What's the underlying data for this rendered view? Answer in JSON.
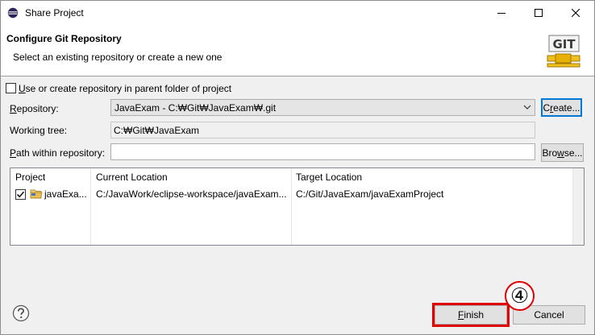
{
  "window": {
    "title": "Share Project"
  },
  "header": {
    "title": "Configure Git Repository",
    "subtitle": "Select an existing repository or create a new one",
    "logo_text": "GIT"
  },
  "form": {
    "use_parent_label_pre": "",
    "use_parent_label_u": "U",
    "use_parent_label_post": "se or create repository in parent folder of project",
    "use_parent_checked": false,
    "repository_label_pre": "",
    "repository_label_u": "R",
    "repository_label_post": "epository:",
    "repository_value": "JavaExam - C:₩Git₩JavaExam₩.git",
    "create_label_pre": "C",
    "create_label_u": "r",
    "create_label_post": "eate...",
    "working_tree_label": "Working tree:",
    "working_tree_value": "C:₩Git₩JavaExam",
    "path_label_pre": "",
    "path_label_u": "P",
    "path_label_post": "ath within repository:",
    "path_value": "",
    "browse_label_pre": "Bro",
    "browse_label_u": "w",
    "browse_label_post": "se..."
  },
  "table": {
    "columns": [
      "Project",
      "Current Location",
      "Target Location"
    ],
    "rows": [
      {
        "checked": true,
        "project": "javaExa...",
        "current": "C:/JavaWork/eclipse-workspace/javaExam...",
        "target": "C:/Git/JavaExam/javaExamProject"
      }
    ]
  },
  "footer": {
    "help_icon": "question-circle-icon",
    "finish_label_pre": "",
    "finish_label_u": "F",
    "finish_label_post": "inish",
    "cancel_label": "Cancel"
  },
  "annotation": {
    "step_marker": "④",
    "color": "#e00000"
  }
}
